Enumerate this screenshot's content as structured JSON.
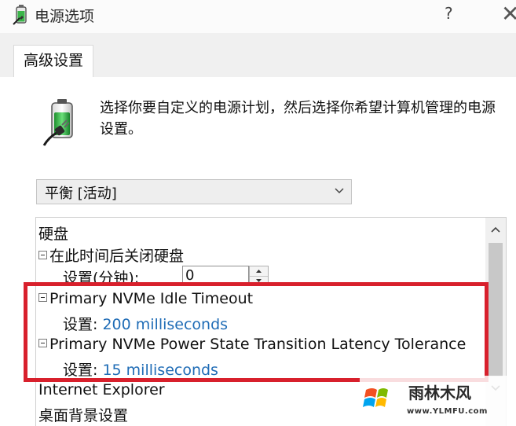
{
  "window": {
    "title": "电源选项",
    "help": "?",
    "close": "✕"
  },
  "tabs": [
    {
      "label": "高级设置",
      "active": true
    }
  ],
  "description": "选择你要自定义的电源计划，然后选择你希望计算机管理的电源设置。",
  "plan_select": {
    "selected": "平衡 [活动]"
  },
  "tree": {
    "items": [
      {
        "label": "硬盘"
      },
      {
        "label": "在此时间后关闭硬盘",
        "setting_label": "设置(分钟):",
        "setting_value": "0"
      },
      {
        "label": "Primary NVMe Idle Timeout",
        "setting_label": "设置:",
        "setting_value": "200 milliseconds"
      },
      {
        "label": "Primary NVMe Power State Transition Latency Tolerance",
        "setting_label": "设置:",
        "setting_value": "15 milliseconds"
      },
      {
        "label": "Internet Explorer"
      },
      {
        "label": "桌面背景设置"
      }
    ]
  },
  "watermark": {
    "brand": "雨林木风",
    "url": "www.YLMFU.com"
  },
  "colors": {
    "accent_link": "#1f6cb6",
    "highlight": "#d8202c"
  }
}
